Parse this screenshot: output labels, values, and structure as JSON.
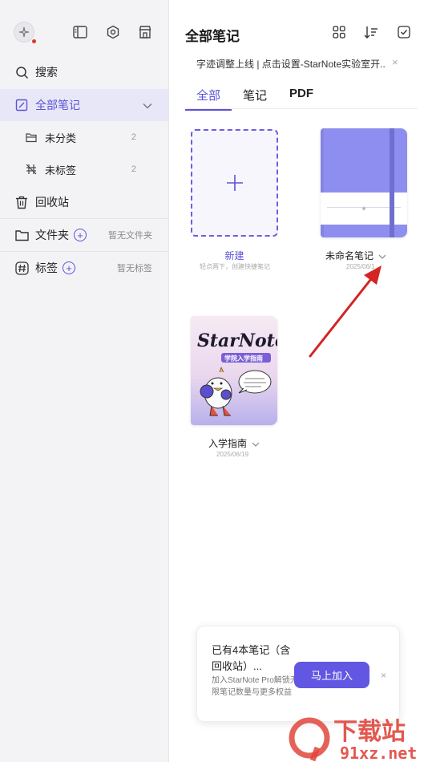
{
  "sidebar": {
    "search": "搜索",
    "all_notes": "全部笔记",
    "uncategorized": "未分类",
    "uncategorized_count": "2",
    "untagged": "未标签",
    "untagged_count": "2",
    "trash": "回收站",
    "folders": "文件夹",
    "folders_empty": "暂无文件夹",
    "tags": "标签",
    "tags_empty": "暂无标签"
  },
  "main": {
    "title": "全部笔记",
    "notice": "字迹调整上线 | 点击设置-StarNote实验室开...",
    "notice_close": "×",
    "tabs": [
      "全部",
      "笔记",
      "PDF"
    ],
    "new_label": "新建",
    "new_sub": "轻点两下，创建快捷笔记",
    "notebook_label": "未命名笔记",
    "notebook_date": "2025/06/1",
    "guide_label": "入学指南",
    "guide_date": "2025/06/19",
    "guide_cover_title": "StarNote",
    "guide_cover_sub": "学院入学指南"
  },
  "promo": {
    "title": "已有4本笔记（含回收站）...",
    "desc": "加入StarNote Pro解锁无限笔记数量与更多权益",
    "button": "马上加入",
    "close": "×"
  },
  "watermark": {
    "text": "下载站",
    "url": "91xz.net"
  },
  "colors": {
    "accent": "#5b52d8",
    "notebook": "#8e8ef0",
    "arrow": "#d42424"
  }
}
